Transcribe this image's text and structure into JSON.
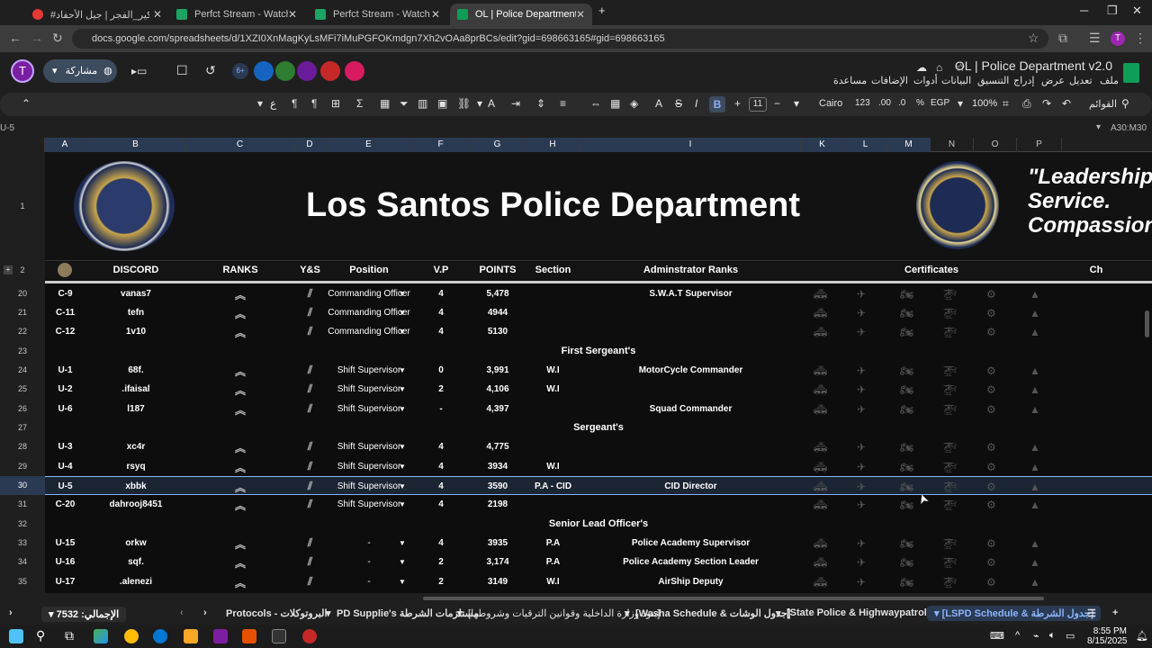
{
  "browser": {
    "tabs": [
      {
        "title": "#باكير_الفجر | جيل الأحفاد...",
        "active": false
      },
      {
        "title": "Perfct Stream - Watch Live",
        "active": false
      },
      {
        "title": "Perfct Stream - Watch Live",
        "active": false
      },
      {
        "title": "OL | Police Department v2.0 - Goo",
        "active": true
      }
    ],
    "url": "docs.google.com/spreadsheets/d/1XZI0XnMagKyLsMFi7iMuPGFOKmdgn7Xh2vOAa8prBCs/edit?gid=698663165#gid=698663165",
    "profile_initial": "T"
  },
  "docs": {
    "title": "OL | Police Department v2.0",
    "menu": [
      "ملف",
      "تعديل",
      "عرض",
      "إدراج",
      "التنسيق",
      "البيانات",
      "أدوات",
      "الإضافات",
      "مساعدة"
    ],
    "share_label": "مشاركة",
    "account_initial": "T",
    "badge_count": "6+"
  },
  "toolbar": {
    "menus_label": "القوائم",
    "zoom": "100%",
    "currency": "EGP",
    "percent": "%",
    "decimals_dec": ".0",
    "decimals_inc": ".00",
    "number_format": "123",
    "font": "Cairo",
    "font_size": "11",
    "bold": "B",
    "italic": "I",
    "strike": "S",
    "text_color": "A"
  },
  "formula_bar": {
    "name_box": "A30:M30",
    "content": "U-5"
  },
  "columns": [
    "A",
    "B",
    "C",
    "D",
    "E",
    "F",
    "G",
    "H",
    "I",
    "K",
    "L",
    "M",
    "N",
    "O",
    "P"
  ],
  "banner": {
    "title": "Los Santos Police Department",
    "quote_line1": "\"Leadership",
    "quote_line2": "Service.",
    "quote_line3": "Compassion"
  },
  "headers": {
    "discord": "DISCORD",
    "ranks": "RANKS",
    "ys": "Y&S",
    "position": "Position",
    "vp": "V.P",
    "points": "POINTS",
    "section": "Section",
    "admin": "Adminstrator Ranks",
    "certificates": "Certificates",
    "extra": "Ch"
  },
  "rows": [
    {
      "rownum": "20",
      "id": "C-9",
      "discord": "vanas7",
      "position": "Commanding Officer",
      "vp": "4",
      "points": "5,478",
      "section": "",
      "admin": "S.W.A.T Supervisor"
    },
    {
      "rownum": "21",
      "id": "C-11",
      "discord": "tefn",
      "position": "Commanding Officer",
      "vp": "4",
      "points": "4944",
      "section": "",
      "admin": ""
    },
    {
      "rownum": "22",
      "id": "C-12",
      "discord": "1v10",
      "position": "Commanding Officer",
      "vp": "4",
      "points": "5130",
      "section": "",
      "admin": ""
    },
    {
      "rownum": "24",
      "id": "U-1",
      "discord": "68f.",
      "position": "Shift Supervisor",
      "vp": "0",
      "points": "3,991",
      "section": "W.I",
      "admin": "MotorCycle Commander"
    },
    {
      "rownum": "25",
      "id": "U-2",
      "discord": ".ifaisal",
      "position": "Shift Supervisor",
      "vp": "2",
      "points": "4,106",
      "section": "W.I",
      "admin": ""
    },
    {
      "rownum": "26",
      "id": "U-6",
      "discord": "l187",
      "position": "Shift Supervisor",
      "vp": "-",
      "points": "4,397",
      "section": "",
      "admin": "Squad Commander"
    },
    {
      "rownum": "28",
      "id": "U-3",
      "discord": "xc4r",
      "position": "Shift Supervisor",
      "vp": "4",
      "points": "4,775",
      "section": "",
      "admin": ""
    },
    {
      "rownum": "29",
      "id": "U-4",
      "discord": "rsyq",
      "position": "Shift Supervisor",
      "vp": "4",
      "points": "3934",
      "section": "W.I",
      "admin": ""
    },
    {
      "rownum": "30",
      "id": "U-5",
      "discord": "xbbk",
      "position": "Shift Supervisor",
      "vp": "4",
      "points": "3590",
      "section": "P.A - CID",
      "admin": "CID Director"
    },
    {
      "rownum": "31",
      "id": "C-20",
      "discord": "dahrooj8451",
      "position": "Shift Supervisor",
      "vp": "4",
      "points": "2198",
      "section": "",
      "admin": ""
    },
    {
      "rownum": "33",
      "id": "U-15",
      "discord": "orkw",
      "position": "-",
      "vp": "4",
      "points": "3935",
      "section": "P.A",
      "admin": "Police Academy Supervisor"
    },
    {
      "rownum": "34",
      "id": "U-16",
      "discord": "sqf.",
      "position": "-",
      "vp": "2",
      "points": "3,174",
      "section": "P.A",
      "admin": "Police Academy Section Leader"
    },
    {
      "rownum": "35",
      "id": "U-17",
      "discord": ".alenezi",
      "position": "-",
      "vp": "2",
      "points": "3149",
      "section": "W.I",
      "admin": "AirShip Deputy"
    }
  ],
  "sections": [
    {
      "rownum": "23",
      "label": "First Sergeant's"
    },
    {
      "rownum": "27",
      "label": "Sergeant's"
    },
    {
      "rownum": "32",
      "label": "Senior Lead Officer's"
    }
  ],
  "row_labels": {
    "r1": "1",
    "r2": "2"
  },
  "sheet_tabs": {
    "total": "الإجمالي: 7532",
    "tabs": [
      "Protocols - البروتوكلات",
      "PD Supplie's مستلزمات الشرطة",
      "[بنود وزارة الداخلية وقوانين الترقيات وشروطها]",
      "[Washa Schedule & جدول الوشات]",
      "[State Police & Highwaypatrol]",
      "[LSPD Schedule & جدول الشرطة]"
    ]
  },
  "taskbar": {
    "time": "8:55 PM",
    "date": "8/15/2025",
    "lang": "ENG"
  },
  "colors": {
    "accent": "#8ab4f8",
    "sheets_green": "#0f9d58",
    "banner_bg": "#121212"
  }
}
